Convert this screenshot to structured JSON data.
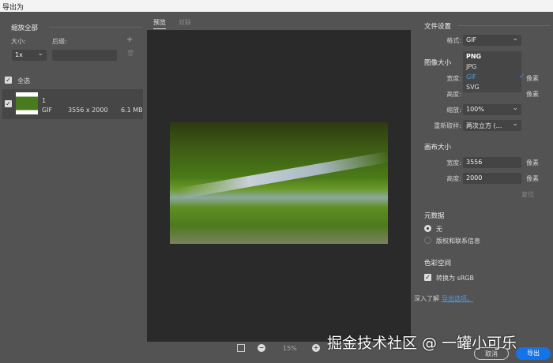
{
  "window": {
    "title": "导出为"
  },
  "left": {
    "scale_all": "缩放全部",
    "size_label": "大小:",
    "suffix_label": "后缀:",
    "size_value": "1x",
    "suffix_value": "",
    "select_all": "全选",
    "asset": {
      "name": "1",
      "format": "GIF",
      "dimensions": "3556 x 2000",
      "filesize": "6.1 MB"
    }
  },
  "center": {
    "tabs": [
      {
        "label": "预览",
        "active": true
      },
      {
        "label": "双联",
        "active": false
      }
    ],
    "zoom": "15%"
  },
  "right": {
    "file_settings": "文件设置",
    "format_label": "格式:",
    "format_value": "GIF",
    "format_options": [
      {
        "label": "PNG",
        "selected": false
      },
      {
        "label": "JPG",
        "selected": false
      },
      {
        "label": "GIF",
        "selected": true
      },
      {
        "label": "SVG",
        "selected": false
      }
    ],
    "image_size": "图像大小",
    "width_label": "宽度:",
    "height_label": "高度:",
    "unit": "像素",
    "scale_label": "缩放:",
    "scale_value": "100%",
    "resample_label": "重新取样:",
    "resample_value": "两次立方 (...",
    "canvas_size": "画布大小",
    "canvas_width": "3556",
    "canvas_height": "2000",
    "reset": "复位",
    "metadata": "元数据",
    "meta_none": "无",
    "meta_copyright": "版权和联系信息",
    "meta_selected": "none",
    "color_space": "色彩空间",
    "srgb": "转换为 sRGB",
    "srgb_checked": true,
    "learn_more": "深入了解",
    "export_options_link": "导出选项。",
    "cancel": "取消",
    "export": "导出"
  },
  "watermark": "掘金技术社区 @ 一罐小可乐",
  "colors": {
    "accent": "#1473e6",
    "link": "#4a9de8"
  }
}
